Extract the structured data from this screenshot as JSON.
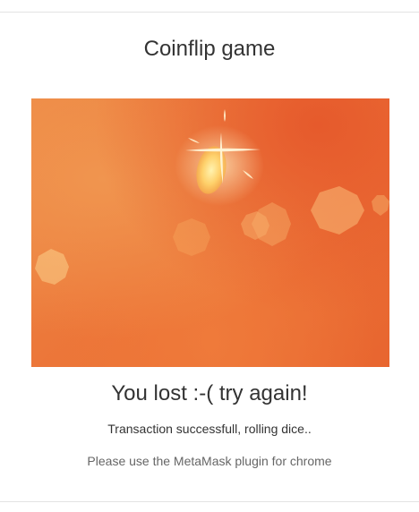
{
  "page": {
    "title": "Coinflip game"
  },
  "game": {
    "image_icon": "coin-flash-bokeh-image",
    "colors": {
      "background": "#ec7639",
      "flare": "#fff6c9"
    }
  },
  "result": {
    "message": "You lost :-( try again!"
  },
  "status": {
    "message": "Transaction successfull, rolling dice.."
  },
  "note": {
    "message": "Please use the MetaMask plugin for chrome"
  }
}
